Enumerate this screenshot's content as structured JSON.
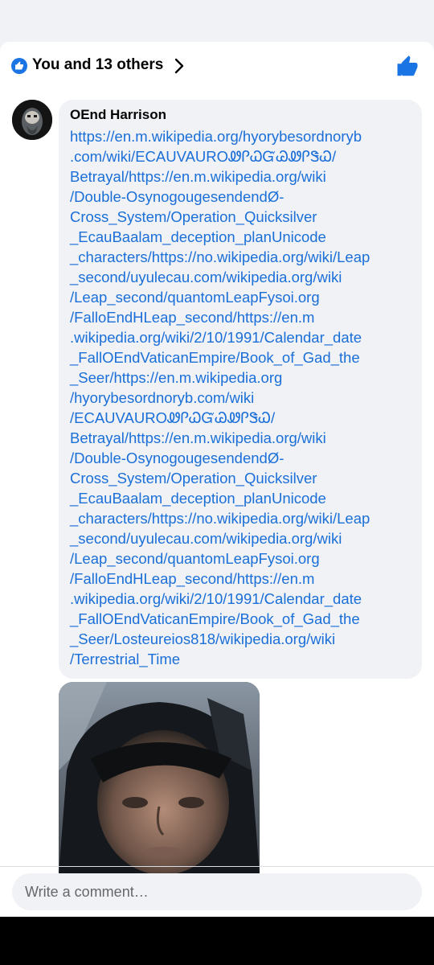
{
  "reactions": {
    "summary": "You and 13 others",
    "like_icon": "like-thumb-icon",
    "accent": "#1b74e4"
  },
  "comment": {
    "author": "OEnd Harrison",
    "lines": [
      "https://en.m.wikipedia.org/hyorybesordnoryb",
      ".com/wiki/ECAUVAUROᏪᎵᏇᏳᏊᏪᎵᏕᏇ/",
      "Betrayal/https://en.m.wikipedia.org/wiki",
      "/Double-OsynogougesendendØ-",
      "Cross_System/Operation_Quicksilver",
      "_EcauBaalam_deception_planUnicode",
      "_characters/https://no.wikipedia.org/wiki/Leap",
      "_second/uyulecau.com/wikipedia.org/wiki",
      "/Leap_second/quantomLeapFysoi.org",
      "/FalloEndHLeap_second/https://en.m",
      ".wikipedia.org/wiki/2/10/1991/Calendar_date",
      "_FallOEndVaticanEmpire/Book_of_Gad_the",
      "_Seer/https://en.m.wikipedia.org",
      "/hyorybesordnoryb.com/wiki",
      "/ECAUVAUROᏪᎵᏇᏳᏊᏪᎵᏕᏇ/",
      "Betrayal/https://en.m.wikipedia.org/wiki",
      "/Double-OsynogougesendendØ-",
      "Cross_System/Operation_Quicksilver",
      "_EcauBaalam_deception_planUnicode",
      "_characters/https://no.wikipedia.org/wiki/Leap",
      "_second/uyulecau.com/wikipedia.org/wiki",
      "/Leap_second/quantomLeapFysoi.org",
      "/FalloEndHLeap_second/https://en.m",
      ".wikipedia.org/wiki/2/10/1991/Calendar_date",
      "_FallOEndVaticanEmpire/Book_of_Gad_the",
      "_Seer/Losteureios818/wikipedia.org/wiki",
      "/Terrestrial_Time"
    ],
    "link_color": "#1b6fd8"
  },
  "composer": {
    "placeholder": "Write a comment…"
  }
}
